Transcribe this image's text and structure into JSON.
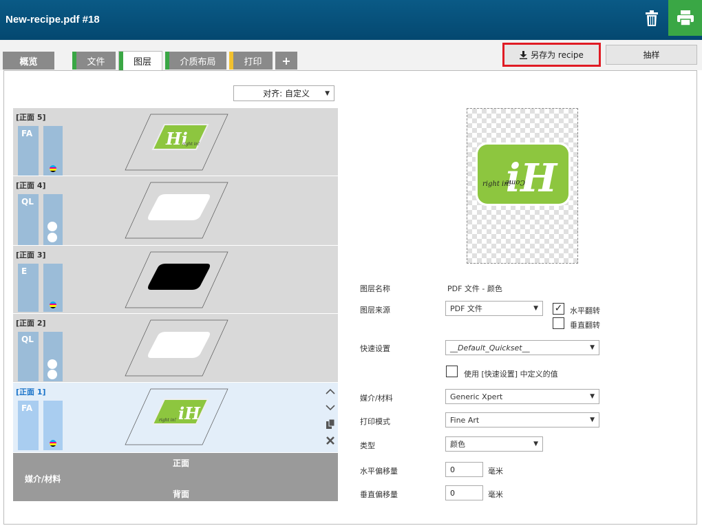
{
  "window": {
    "title": "New-recipe.pdf #18"
  },
  "tabs": [
    {
      "label": "概览",
      "marker": ""
    },
    {
      "label": "文件",
      "marker": "#3aa745"
    },
    {
      "label": "图层",
      "marker": "#3aa745"
    },
    {
      "label": "介质布局",
      "marker": "#3aa745"
    },
    {
      "label": "打印",
      "marker": "#f2c12e"
    },
    {
      "label": "+",
      "marker": ""
    }
  ],
  "actions": {
    "save_recipe": "另存为 recipe",
    "sample": "抽样"
  },
  "align": {
    "label": "对齐: 自定义"
  },
  "layers": [
    {
      "name": "[正面 5]",
      "code": "FA"
    },
    {
      "name": "[正面 4]",
      "code": "QL"
    },
    {
      "name": "[正面 3]",
      "code": "E"
    },
    {
      "name": "[正面 2]",
      "code": "QL"
    },
    {
      "name": "[正面 1]",
      "code": "FA"
    }
  ],
  "thumb_text": {
    "hi": "Hi",
    "ih": "iH",
    "script_line1": "Come",
    "script_line2": "right in!"
  },
  "footer": {
    "front": "正面",
    "media": "媒介/材料",
    "back": "背面"
  },
  "properties": {
    "layer_name_label": "图层名称",
    "layer_name_value": "PDF 文件 - 颜色",
    "layer_source_label": "图层来源",
    "layer_source_value": "PDF 文件",
    "flip_h_label": "水平翻转",
    "flip_v_label": "垂直翻转",
    "quickset_label": "快速设置",
    "quickset_value": "__Default_Quickset__",
    "use_quickset_label": "使用 [快速设置] 中定义的值",
    "media_label": "媒介/材料",
    "media_value": "Generic Xpert",
    "print_mode_label": "打印模式",
    "print_mode_value": "Fine Art",
    "type_label": "类型",
    "type_value": "颜色",
    "h_offset_label": "水平偏移量",
    "h_offset_value": "0",
    "v_offset_label": "垂直偏移量",
    "v_offset_value": "0",
    "unit": "毫米"
  },
  "colors": {
    "accent_green": "#3aa745",
    "brand_blue": "#0a5a86",
    "logo_green": "#8dc63f",
    "highlight_red": "#e01b24"
  }
}
